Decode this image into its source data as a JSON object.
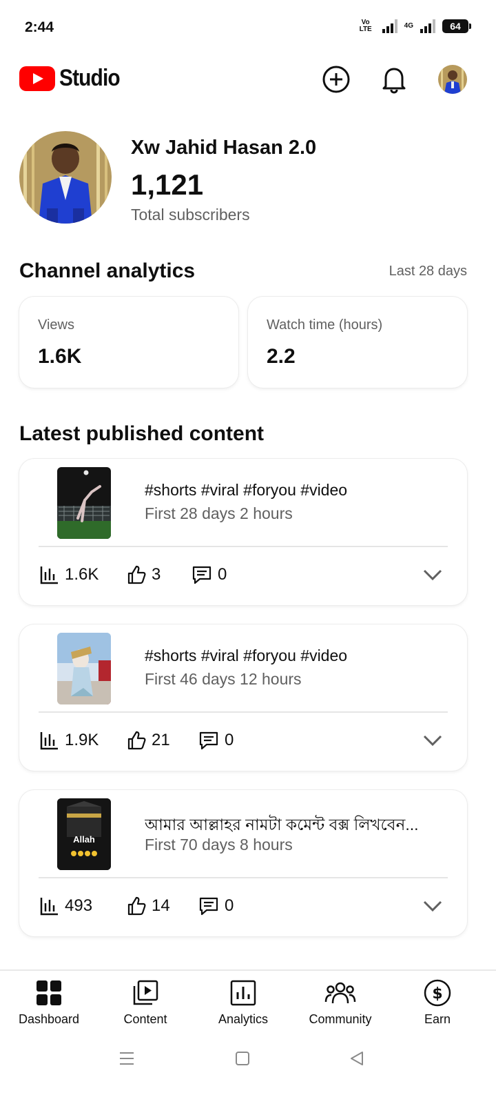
{
  "status_bar": {
    "time": "2:44",
    "network_1": "Vo LTE",
    "network_2": "4G",
    "battery": "64"
  },
  "header": {
    "logo_text": "Studio",
    "brand_color": "#ff0000",
    "icons": [
      "create-icon",
      "bell-icon",
      "account-avatar"
    ]
  },
  "channel": {
    "name": "Xw Jahid Hasan 2.0",
    "subscriber_count": "1,121",
    "subscriber_label": "Total subscribers"
  },
  "analytics": {
    "title": "Channel analytics",
    "period": "Last 28 days",
    "cards": [
      {
        "label": "Views",
        "value": "1.6K"
      },
      {
        "label": "Watch time (hours)",
        "value": "2.2"
      }
    ]
  },
  "latest": {
    "title": "Latest published content",
    "items": [
      {
        "title": "#shorts #viral #foryou #video",
        "subtitle": "First 28 days 2 hours",
        "views": "1.6K",
        "likes": "3",
        "comments": "0"
      },
      {
        "title": "#shorts #viral #foryou #video",
        "subtitle": "First 46 days 12 hours",
        "views": "1.9K",
        "likes": "21",
        "comments": "0"
      },
      {
        "title": "আমার আল্লাহর নামটা কমেন্ট বক্স লিখবেন...",
        "subtitle": "First 70 days 8 hours",
        "views": "493",
        "likes": "14",
        "comments": "0",
        "thumb_text": "Allah"
      }
    ]
  },
  "bottom_nav": {
    "items": [
      {
        "label": "Dashboard",
        "icon": "dashboard-icon"
      },
      {
        "label": "Content",
        "icon": "content-icon"
      },
      {
        "label": "Analytics",
        "icon": "analytics-icon"
      },
      {
        "label": "Community",
        "icon": "community-icon"
      },
      {
        "label": "Earn",
        "icon": "earn-icon"
      }
    ]
  }
}
